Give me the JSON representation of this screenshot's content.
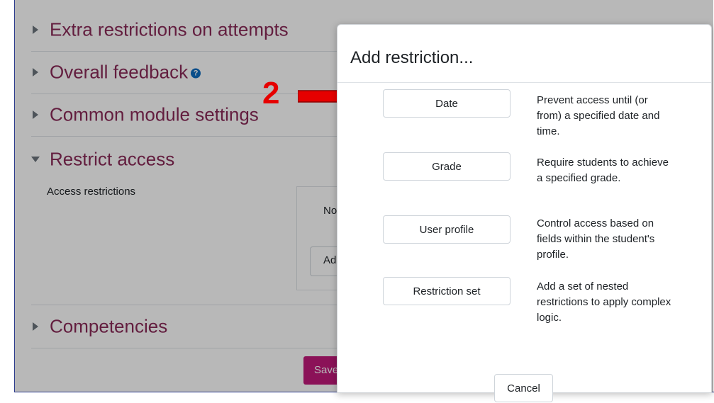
{
  "sections": [
    {
      "label": "Extra restrictions on attempts",
      "expanded": false
    },
    {
      "label": "Overall feedback",
      "expanded": false,
      "help": true
    },
    {
      "label": "Common module settings",
      "expanded": false
    },
    {
      "label": "Restrict access",
      "expanded": true
    },
    {
      "label": "Competencies",
      "expanded": false
    }
  ],
  "restrict": {
    "access_label": "Access restrictions",
    "none_text": "No",
    "add_button": "Ad"
  },
  "save_button": "Save",
  "modal": {
    "title": "Add restriction...",
    "options": [
      {
        "button": "Date",
        "description": "Prevent access until (or from) a specified date and time."
      },
      {
        "button": "Grade",
        "description": "Require students to achieve a specified grade."
      },
      {
        "button": "User profile",
        "description": "Control access based on fields within the student's profile."
      },
      {
        "button": "Restriction set",
        "description": "Add a set of nested restrictions to apply complex logic."
      }
    ],
    "cancel": "Cancel"
  },
  "annotation": {
    "number": "2"
  },
  "colors": {
    "section_link": "#8a2a58",
    "save": "#c11a7b",
    "annotation": "#e60000"
  }
}
